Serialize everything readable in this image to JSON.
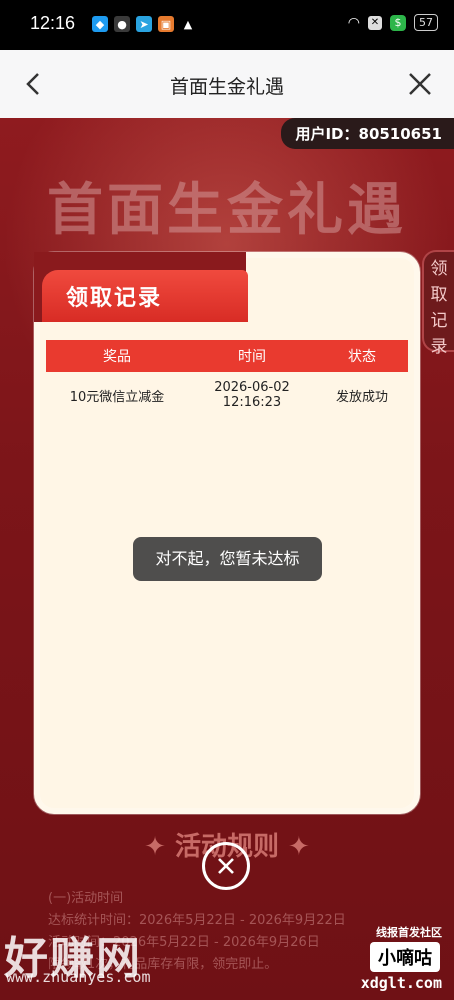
{
  "status_bar": {
    "time": "12:16",
    "battery": "57"
  },
  "nav": {
    "title": "首面生金礼遇"
  },
  "page": {
    "user_id": "用户ID：80510651",
    "big_title": "首面生金礼遇",
    "side_tab": "领取记录",
    "rules_title": "✦ 活动规则 ✦",
    "rules_lines": [
      "(一)活动时间",
      "达标统计时间：2026年5月22日 - 2026年9月22日",
      "活动时间：2026年5月22日 - 2026年9月26日",
      "限领取1次，礼品库存有限，领完即止。"
    ]
  },
  "popup": {
    "title": "领取记录",
    "columns": [
      "奖品",
      "时间",
      "状态"
    ],
    "rows": [
      {
        "prize": "10元微信立减金",
        "time": "2026-06-02 12:16:23",
        "status": "发放成功"
      }
    ]
  },
  "toast": {
    "text": "对不起，您暂未达标"
  },
  "watermark": {
    "left_text": "好赚网",
    "left_url": "www.zhuanyes.com",
    "right_top": "线报首发社区",
    "right_box": "小嘀咕",
    "right_url": "xdglt.com"
  }
}
